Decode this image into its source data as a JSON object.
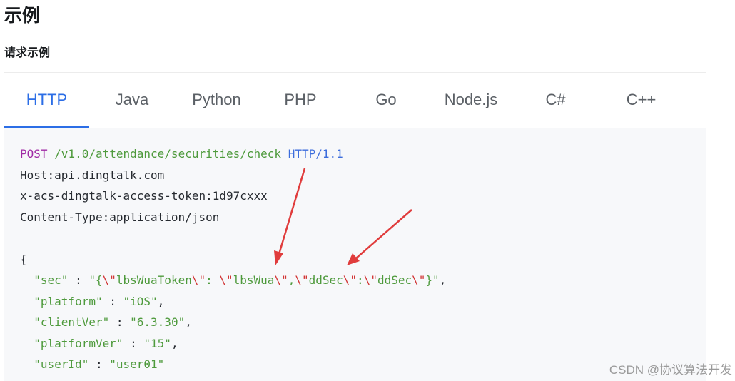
{
  "page_title": "示例",
  "section_title": "请求示例",
  "tabs": [
    "HTTP",
    "Java",
    "Python",
    "PHP",
    "Go",
    "Node.js",
    "C#",
    "C++"
  ],
  "active_tab": "HTTP",
  "request": {
    "method": "POST",
    "path": "/v1.0/attendance/securities/check",
    "protocol": "HTTP/1.1",
    "host_header": "Host:api.dingtalk.com",
    "token_header": "x-acs-dingtalk-access-token:1d97cxxx",
    "content_type_header": "Content-Type:application/json",
    "open_brace": "{",
    "body": [
      {
        "key": "\"sec\"",
        "sep": " : ",
        "value": "\"{\\\"lbsWuaToken\\\": \\\"lbsWua\\\",\\\"ddSec\\\":\\\"ddSec\\\"}\"",
        "comma": ","
      },
      {
        "key": "\"platform\"",
        "sep": " : ",
        "value": "\"iOS\"",
        "comma": ","
      },
      {
        "key": "\"clientVer\"",
        "sep": " : ",
        "value": "\"6.3.30\"",
        "comma": ","
      },
      {
        "key": "\"platformVer\"",
        "sep": " : ",
        "value": "\"15\"",
        "comma": ","
      },
      {
        "key": "\"userId\"",
        "sep": " : ",
        "value": "\"user01\"",
        "comma": ""
      }
    ]
  },
  "colors": {
    "accent": "#2c6ee6",
    "keyword": "#a02aa5",
    "string": "#4e9a3c",
    "protocol": "#3c6ddc",
    "escape": "#d23535",
    "annotation_arrow": "#e03c3c"
  },
  "watermark": "CSDN @协议算法开发"
}
